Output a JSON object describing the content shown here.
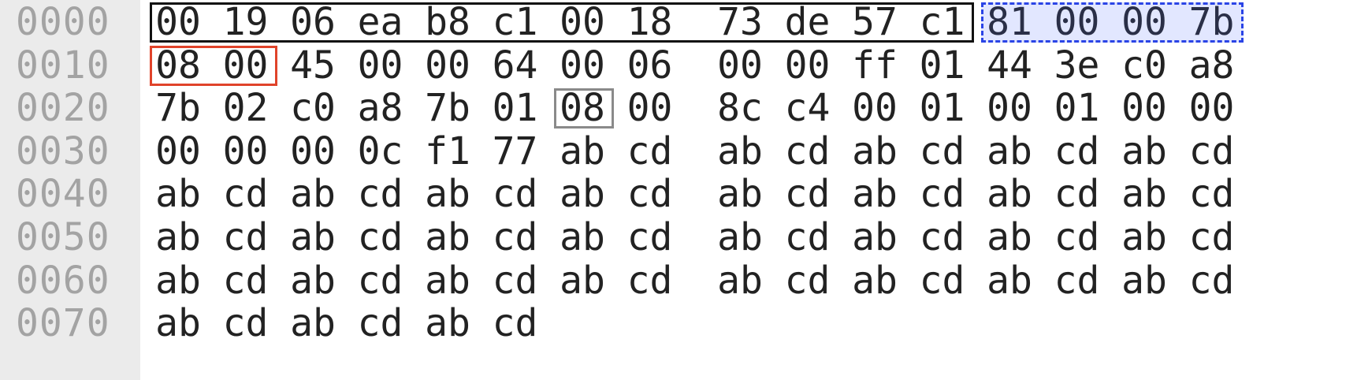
{
  "hexdump": {
    "rows": [
      {
        "offset": "0000",
        "bytes": [
          "00",
          "19",
          "06",
          "ea",
          "b8",
          "c1",
          "00",
          "18",
          "73",
          "de",
          "57",
          "c1",
          "81",
          "00",
          "00",
          "7b"
        ]
      },
      {
        "offset": "0010",
        "bytes": [
          "08",
          "00",
          "45",
          "00",
          "00",
          "64",
          "00",
          "06",
          "00",
          "00",
          "ff",
          "01",
          "44",
          "3e",
          "c0",
          "a8"
        ]
      },
      {
        "offset": "0020",
        "bytes": [
          "7b",
          "02",
          "c0",
          "a8",
          "7b",
          "01",
          "08",
          "00",
          "8c",
          "c4",
          "00",
          "01",
          "00",
          "01",
          "00",
          "00"
        ]
      },
      {
        "offset": "0030",
        "bytes": [
          "00",
          "00",
          "00",
          "0c",
          "f1",
          "77",
          "ab",
          "cd",
          "ab",
          "cd",
          "ab",
          "cd",
          "ab",
          "cd",
          "ab",
          "cd"
        ]
      },
      {
        "offset": "0040",
        "bytes": [
          "ab",
          "cd",
          "ab",
          "cd",
          "ab",
          "cd",
          "ab",
          "cd",
          "ab",
          "cd",
          "ab",
          "cd",
          "ab",
          "cd",
          "ab",
          "cd"
        ]
      },
      {
        "offset": "0050",
        "bytes": [
          "ab",
          "cd",
          "ab",
          "cd",
          "ab",
          "cd",
          "ab",
          "cd",
          "ab",
          "cd",
          "ab",
          "cd",
          "ab",
          "cd",
          "ab",
          "cd"
        ]
      },
      {
        "offset": "0060",
        "bytes": [
          "ab",
          "cd",
          "ab",
          "cd",
          "ab",
          "cd",
          "ab",
          "cd",
          "ab",
          "cd",
          "ab",
          "cd",
          "ab",
          "cd",
          "ab",
          "cd"
        ]
      },
      {
        "offset": "0070",
        "bytes": [
          "ab",
          "cd",
          "ab",
          "cd",
          "ab",
          "cd"
        ]
      }
    ]
  },
  "highlights": [
    {
      "name": "ethernet-address-highlight",
      "row": 0,
      "start": 0,
      "end": 11,
      "style": "solid",
      "color": "#111111"
    },
    {
      "name": "vlan-tag-highlight",
      "row": 0,
      "start": 12,
      "end": 15,
      "style": "dashed-fill",
      "color": "#2a44e6"
    },
    {
      "name": "ethertype-highlight",
      "row": 1,
      "start": 0,
      "end": 1,
      "style": "solid",
      "color": "#e0432a"
    },
    {
      "name": "icmp-type-highlight",
      "row": 2,
      "start": 6,
      "end": 6,
      "style": "solid",
      "color": "#8a8a8a"
    }
  ],
  "colors": {
    "gutter_background": "#ebebeb",
    "offset_text": "#a3a3a3",
    "byte_text": "#222222"
  }
}
